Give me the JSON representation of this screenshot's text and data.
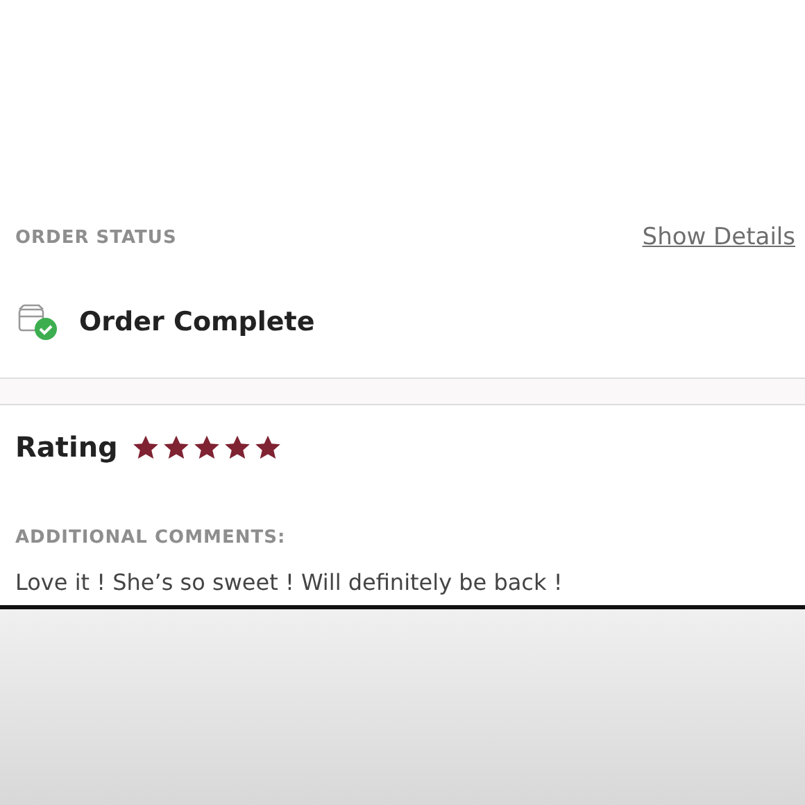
{
  "order_status": {
    "heading": "ORDER STATUS",
    "link": "Show Details",
    "status": "Order Complete"
  },
  "rating": {
    "label": "Rating",
    "stars": 5
  },
  "comments": {
    "heading": "ADDITIONAL COMMENTS:",
    "text": "Love it ! She’s so sweet ! Will definitely be back !"
  }
}
